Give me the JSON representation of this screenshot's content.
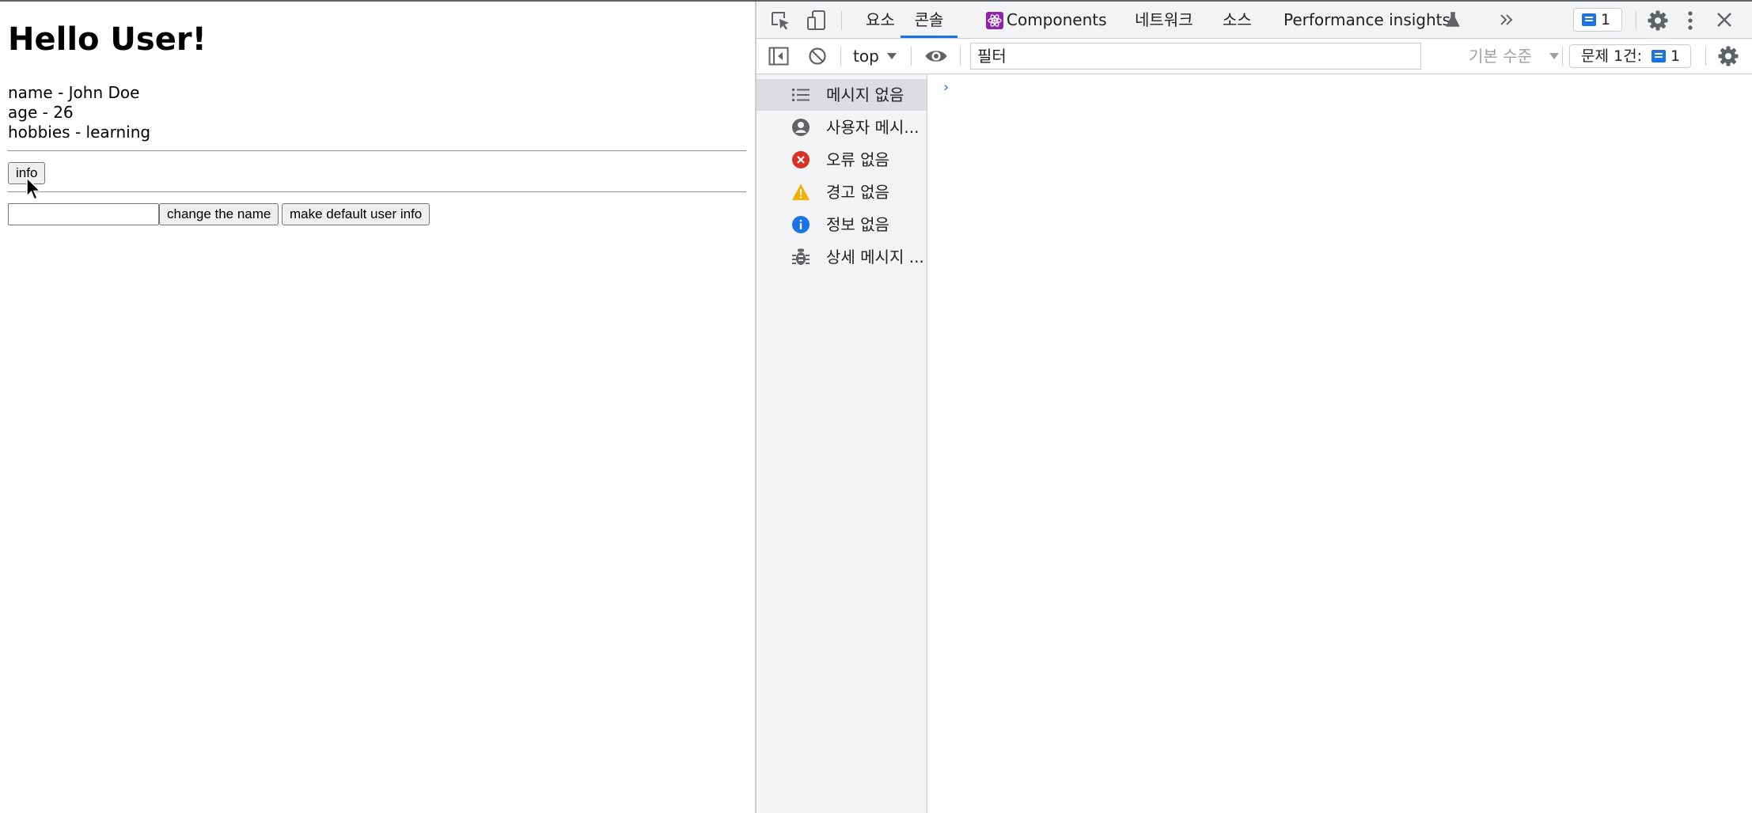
{
  "page": {
    "title": "Hello User!",
    "info_lines": [
      "name - John Doe",
      "age - 26",
      "hobbies - learning"
    ],
    "info_button": "info",
    "name_input_value": "",
    "change_name_button": "change the name",
    "default_info_button": "make default user info"
  },
  "devtools": {
    "tabs": [
      "요소",
      "콘솔",
      "Components",
      "네트워크",
      "소스",
      "Performance insights"
    ],
    "active_tab": "콘솔",
    "issues_count": "1",
    "context": "top",
    "filter_placeholder": "필터",
    "level": "기본 수준",
    "issues_label": "문제 1건:",
    "issues_badge_count": "1",
    "sidebar": [
      {
        "label": "메시지 없음",
        "icon": "list-icon"
      },
      {
        "label": "사용자 메시...",
        "icon": "user-icon"
      },
      {
        "label": "오류 없음",
        "icon": "error-icon"
      },
      {
        "label": "경고 없음",
        "icon": "warning-icon"
      },
      {
        "label": "정보 없음",
        "icon": "info-icon"
      },
      {
        "label": "상세 메시지 ...",
        "icon": "bug-icon"
      }
    ],
    "prompt": "›",
    "colors": {
      "accent": "#1a73e8",
      "error": "#d93025",
      "warning": "#f9ab00",
      "panel": "#f1f3f4"
    }
  }
}
